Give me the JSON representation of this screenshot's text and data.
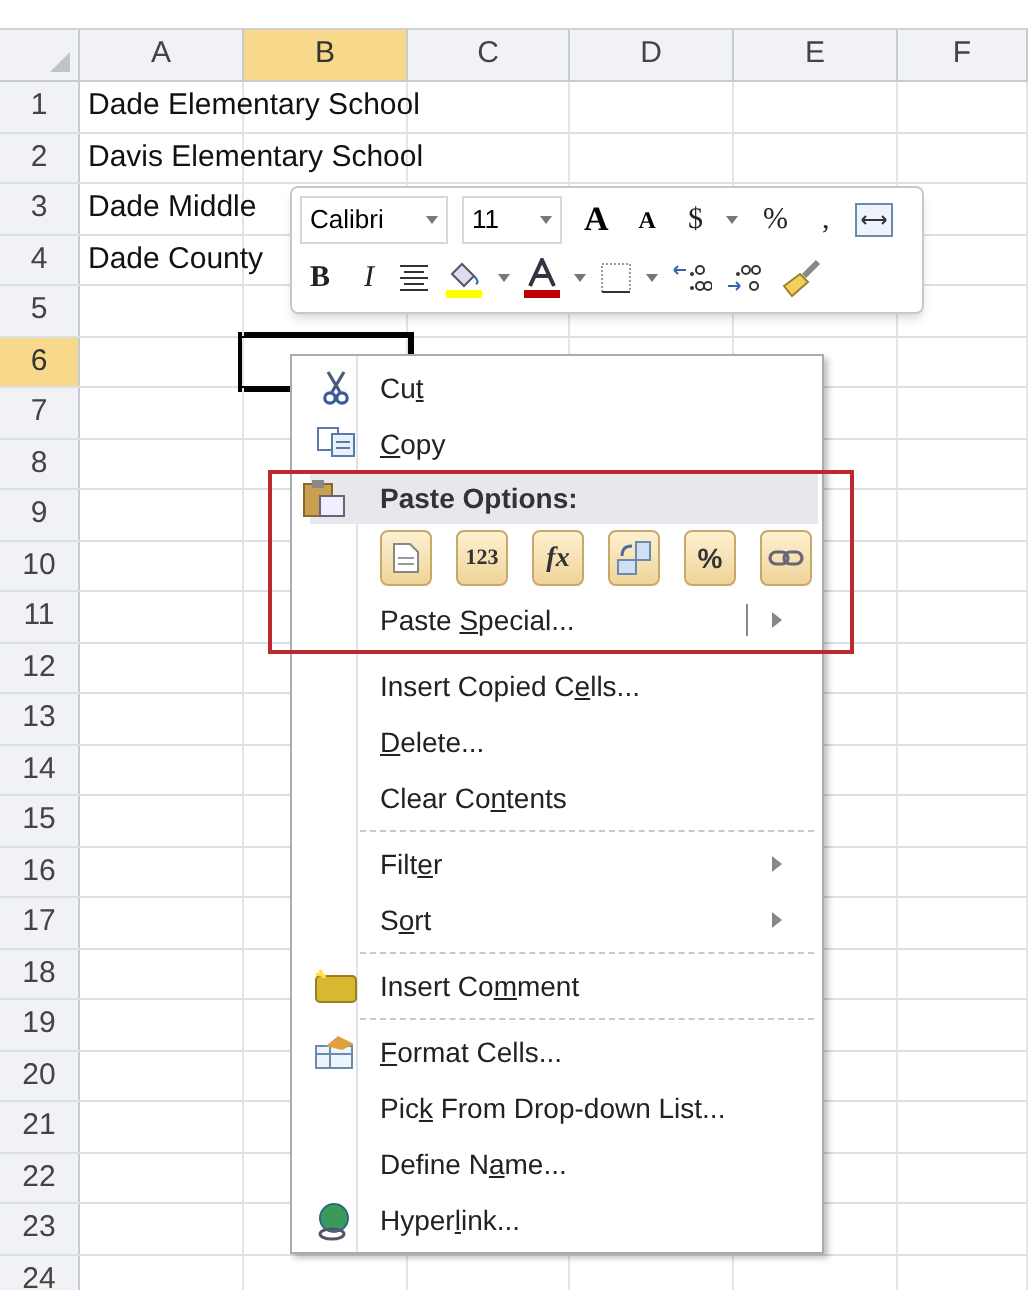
{
  "sheet": {
    "columns": [
      {
        "label": "A",
        "selected": false
      },
      {
        "label": "B",
        "selected": true
      },
      {
        "label": "C",
        "selected": false
      },
      {
        "label": "D",
        "selected": false
      },
      {
        "label": "E",
        "selected": false
      },
      {
        "label": "F",
        "selected": false
      }
    ],
    "rows": [
      {
        "label": "1",
        "selected": false,
        "column_a": "Dade Elementary School"
      },
      {
        "label": "2",
        "selected": false,
        "column_a": "Davis Elementary School"
      },
      {
        "label": "3",
        "selected": false,
        "column_a": "Dade Middle"
      },
      {
        "label": "4",
        "selected": false,
        "column_a": "Dade County"
      },
      {
        "label": "5",
        "selected": false
      },
      {
        "label": "6",
        "selected": true
      },
      {
        "label": "7",
        "selected": false
      },
      {
        "label": "8",
        "selected": false
      },
      {
        "label": "9",
        "selected": false
      },
      {
        "label": "10",
        "selected": false
      },
      {
        "label": "11",
        "selected": false
      },
      {
        "label": "12",
        "selected": false
      },
      {
        "label": "13",
        "selected": false
      },
      {
        "label": "14",
        "selected": false
      },
      {
        "label": "15",
        "selected": false
      },
      {
        "label": "16",
        "selected": false
      },
      {
        "label": "17",
        "selected": false
      },
      {
        "label": "18",
        "selected": false
      },
      {
        "label": "19",
        "selected": false
      },
      {
        "label": "20",
        "selected": false
      },
      {
        "label": "21",
        "selected": false
      },
      {
        "label": "22",
        "selected": false
      },
      {
        "label": "23",
        "selected": false
      },
      {
        "label": "24",
        "selected": false
      }
    ]
  },
  "mini_toolbar": {
    "font_row": [
      {
        "kind": "font",
        "value": "Calibri"
      },
      {
        "kind": "size",
        "value": "11"
      },
      {
        "kind": "grow",
        "label": "A"
      },
      {
        "kind": "shrink",
        "label": "A"
      },
      {
        "kind": "text",
        "label": "$"
      },
      {
        "kind": "arrow"
      },
      {
        "kind": "text",
        "label": "%"
      },
      {
        "kind": "text",
        "label": ","
      },
      {
        "kind": "wrap"
      }
    ],
    "format_row": [
      {
        "kind": "bold",
        "label": "B"
      },
      {
        "kind": "italic",
        "label": "I"
      },
      {
        "kind": "center"
      },
      {
        "kind": "fill"
      },
      {
        "kind": "arrow"
      },
      {
        "kind": "fontcolor"
      },
      {
        "kind": "arrow"
      },
      {
        "kind": "borders"
      },
      {
        "kind": "arrow"
      },
      {
        "kind": "incdec"
      },
      {
        "kind": "decdec"
      },
      {
        "kind": "painter"
      }
    ]
  },
  "context_menu": {
    "items": [
      {
        "kind": "cut",
        "label": {
          "before": "Cu",
          "key": "t"
        }
      },
      {
        "kind": "copy",
        "label": {
          "key": "C",
          "after": "opy"
        }
      },
      {
        "kind": "group",
        "highlighted": true,
        "items": [
          {
            "kind": "header",
            "label": {
              "before": "Paste Options:"
            }
          },
          {
            "kind": "options",
            "options": [
              {
                "kind": "paste"
              },
              {
                "kind": "values",
                "label": "123"
              },
              {
                "kind": "formulas",
                "label": "fx"
              },
              {
                "kind": "transpose"
              },
              {
                "kind": "formatting",
                "label": "%"
              },
              {
                "kind": "link"
              }
            ]
          },
          {
            "kind": "split",
            "label": {
              "before": "Paste ",
              "key": "S",
              "after": "pecial..."
            }
          }
        ]
      },
      {
        "kind": "separator"
      },
      {
        "kind": "item",
        "label": {
          "before": "Insert Copied C",
          "key": "e",
          "after": "lls..."
        }
      },
      {
        "kind": "item",
        "label": {
          "key": "D",
          "after": "elete..."
        }
      },
      {
        "kind": "item",
        "label": {
          "before": "Clear Co",
          "key": "n",
          "after": "tents"
        }
      },
      {
        "kind": "separator"
      },
      {
        "kind": "item",
        "label": {
          "before": "Filt",
          "key": "e",
          "after": "r"
        },
        "submenu": true
      },
      {
        "kind": "item",
        "label": {
          "before": "S",
          "key": "o",
          "after": "rt"
        },
        "submenu": true
      },
      {
        "kind": "separator"
      },
      {
        "kind": "comment",
        "label": {
          "before": "Insert Co",
          "key": "m",
          "after": "ment"
        }
      },
      {
        "kind": "separator"
      },
      {
        "kind": "format",
        "label": {
          "key": "F",
          "after": "ormat Cells..."
        }
      },
      {
        "kind": "item",
        "label": {
          "before": "Pic",
          "key": "k",
          "after": " From Drop-down List..."
        }
      },
      {
        "kind": "item",
        "label": {
          "before": "Define N",
          "key": "a",
          "after": "me..."
        }
      },
      {
        "kind": "hyperlink",
        "label": {
          "before": "Hyper",
          "key": "l",
          "after": "ink..."
        }
      }
    ]
  }
}
